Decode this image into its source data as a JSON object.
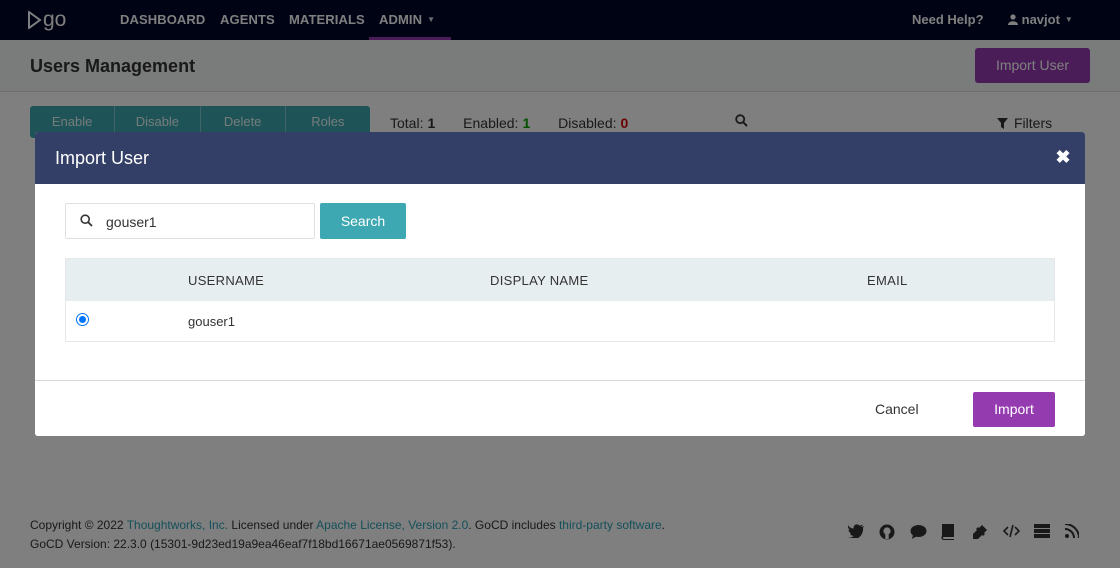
{
  "topnav": {
    "logo_text": "go",
    "items": [
      "DASHBOARD",
      "AGENTS",
      "MATERIALS",
      "ADMIN"
    ],
    "help": "Need Help?",
    "user": "navjot"
  },
  "page": {
    "title": "Users Management",
    "import_user_label": "Import User"
  },
  "toolbar": {
    "bulk_actions": [
      "Enable",
      "Disable",
      "Delete",
      "Roles"
    ],
    "total_label": "Total:",
    "total_value": "1",
    "enabled_label": "Enabled:",
    "enabled_value": "1",
    "disabled_label": "Disabled:",
    "disabled_value": "0",
    "filters_label": "Filters"
  },
  "modal": {
    "title": "Import User",
    "search": {
      "value": "gouser1",
      "button": "Search"
    },
    "table": {
      "headers": [
        "USERNAME",
        "DISPLAY NAME",
        "EMAIL"
      ],
      "rows": [
        {
          "selected": true,
          "username": "gouser1",
          "display_name": "",
          "email": ""
        }
      ]
    },
    "cancel_label": "Cancel",
    "import_label": "Import"
  },
  "footer": {
    "copyright_prefix": "Copyright © 2022 ",
    "company_link": "Thoughtworks, Inc.",
    "licensed_under": " Licensed under ",
    "license_link": "Apache License, Version 2.0",
    "gocd_includes": ". GoCD includes ",
    "third_party_link": "third-party software",
    "period": ".",
    "version_line": "GoCD Version: 22.3.0 (15301-9d23ed19a9ea46eaf7f18bd16671ae0569871f53)."
  },
  "colors": {
    "nav_bg": "#000728",
    "accent_purple": "#943bb0",
    "accent_teal": "#3da8b1",
    "modal_header": "#333f66"
  }
}
